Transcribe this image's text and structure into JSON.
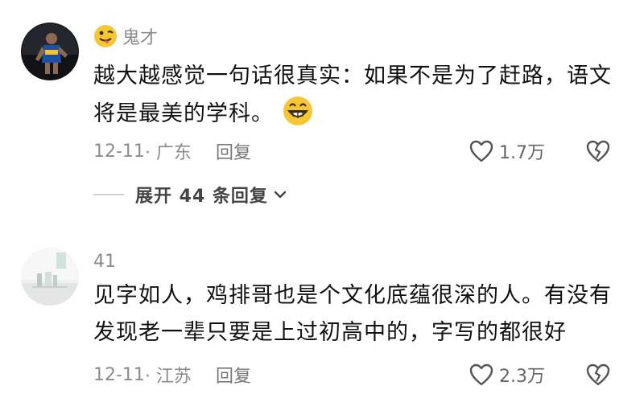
{
  "comments": [
    {
      "username": "鬼才",
      "body": "越大越感觉一句话很真实：如果不是为了赶路，语文将是最美的学科。",
      "date": "12-11",
      "location": "· 广东",
      "reply_label": "回复",
      "likes": "1.7万",
      "expand_label": "展开 44 条回复"
    },
    {
      "username": "41",
      "body": "见字如人，鸡排哥也是个文化底蕴很深的人。有没有发现老一辈只要是上过初高中的，字写的都很好",
      "date": "12-11",
      "location": "· 江苏",
      "reply_label": "回复",
      "likes": "2.3万"
    }
  ],
  "icons": {
    "badge": "tongue-out-emoji-icon",
    "inline": "grinning-emoji-icon",
    "like": "heart-outline-icon",
    "dislike": "broken-heart-icon",
    "expand": "chevron-down-icon"
  }
}
